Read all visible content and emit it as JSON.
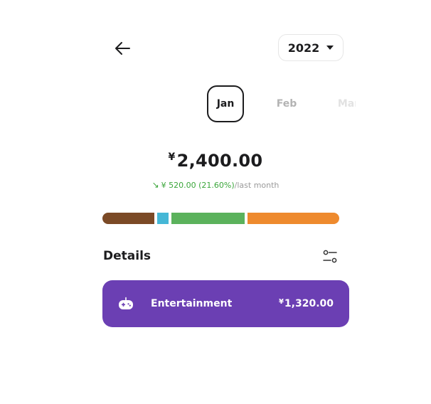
{
  "header": {
    "back_icon": "arrow-left-icon",
    "year": "2022",
    "year_caret_icon": "caret-down-icon"
  },
  "months": [
    {
      "label": "Jan",
      "selected": true
    },
    {
      "label": "Feb",
      "selected": false
    },
    {
      "label": "Mar",
      "selected": false
    }
  ],
  "summary": {
    "currency": "¥",
    "total": "2,400.00",
    "change_icon": "trend-down-arrow-icon",
    "change_amount": "¥ 520.00 (21.60%)",
    "change_suffix": "/last month",
    "change_color": "#3aa63a"
  },
  "breakdown_bar": [
    {
      "color": "#7b4a26",
      "fraction": 0.22
    },
    {
      "color": "#45b7d6",
      "fraction": 0.045
    },
    {
      "color": "#5bb25c",
      "fraction": 0.31
    },
    {
      "color": "#ee8a2e",
      "fraction": 0.385
    }
  ],
  "details": {
    "title": "Details",
    "filter_icon": "sliders-icon"
  },
  "categories": [
    {
      "name": "Entertainment",
      "currency": "¥",
      "amount": "1,320.00",
      "icon": "gamepad-icon",
      "color": "#6b3fb3"
    }
  ]
}
